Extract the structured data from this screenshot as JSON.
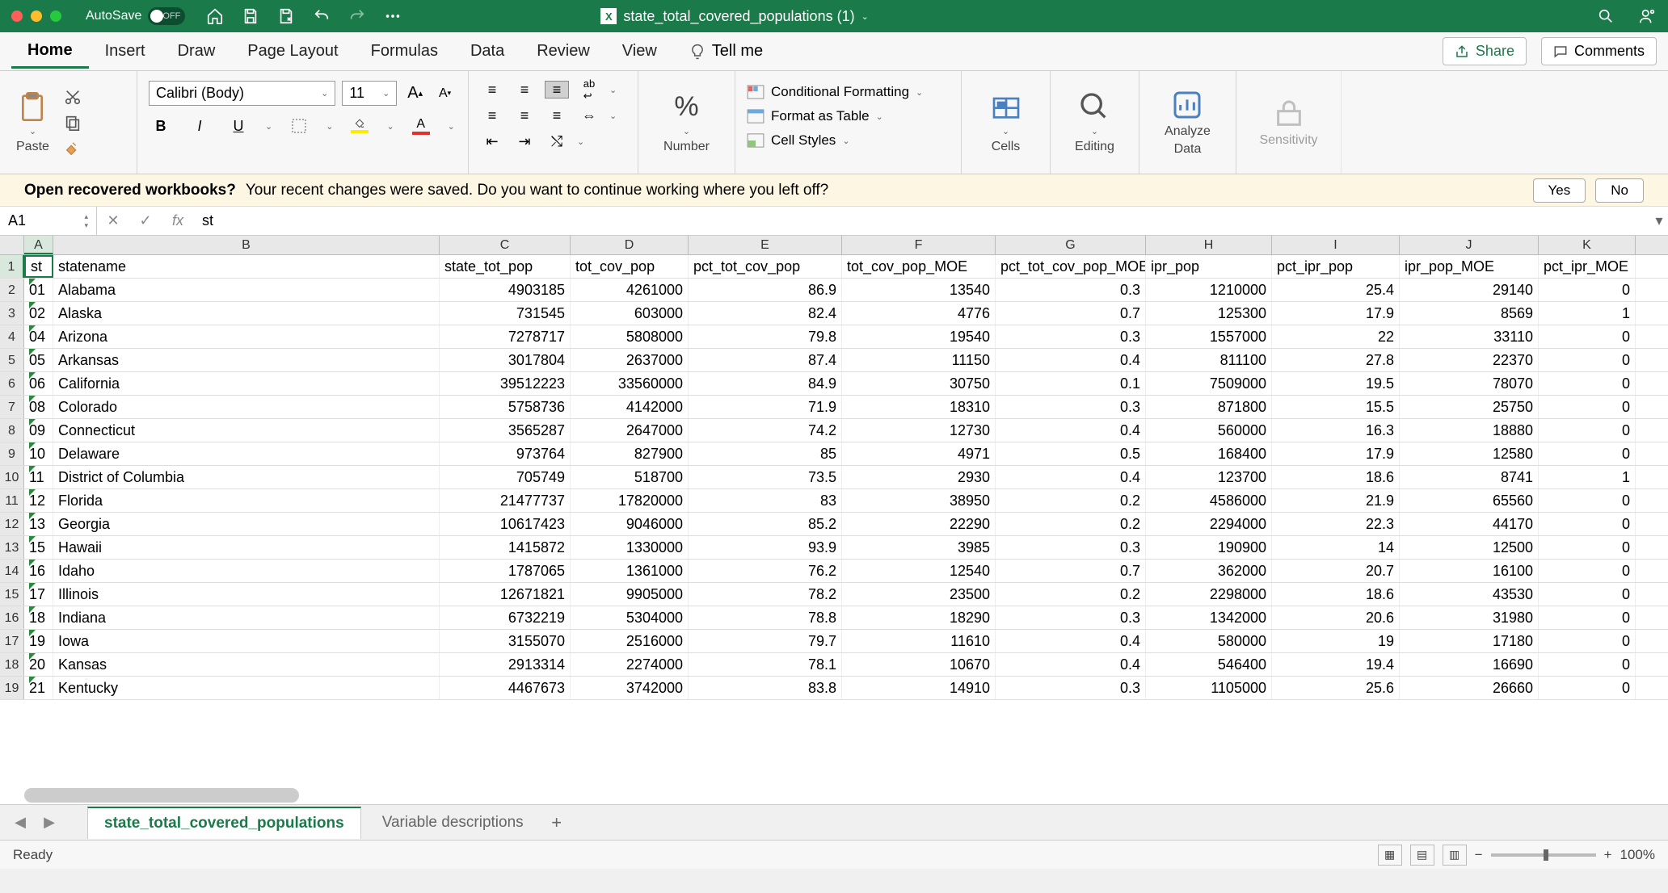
{
  "titlebar": {
    "autosave_label": "AutoSave",
    "toggle_label": "OFF",
    "doc_name": "state_total_covered_populations (1)"
  },
  "tabs": {
    "home": "Home",
    "insert": "Insert",
    "draw": "Draw",
    "pagelayout": "Page Layout",
    "formulas": "Formulas",
    "data": "Data",
    "review": "Review",
    "view": "View",
    "tellme": "Tell me",
    "share": "Share",
    "comments": "Comments"
  },
  "ribbon": {
    "paste": "Paste",
    "font_name": "Calibri (Body)",
    "font_size": "11",
    "number": "Number",
    "condfmt": "Conditional Formatting",
    "fmttable": "Format as Table",
    "cellstyles": "Cell Styles",
    "cells": "Cells",
    "editing": "Editing",
    "analyze": "Analyze",
    "analyze2": "Data",
    "sensitivity": "Sensitivity"
  },
  "recover": {
    "title": "Open recovered workbooks?",
    "msg": "Your recent changes were saved. Do you want to continue working where you left off?",
    "yes": "Yes",
    "no": "No"
  },
  "namebox": "A1",
  "formula": "st",
  "columns": [
    "A",
    "B",
    "C",
    "D",
    "E",
    "F",
    "G",
    "H",
    "I",
    "J",
    "K"
  ],
  "headers": [
    "st",
    "statename",
    "state_tot_pop",
    "tot_cov_pop",
    "pct_tot_cov_pop",
    "tot_cov_pop_MOE",
    "pct_tot_cov_pop_MOE",
    "ipr_pop",
    "pct_ipr_pop",
    "ipr_pop_MOE",
    "pct_ipr_MOE"
  ],
  "rows": [
    [
      "01",
      "Alabama",
      "4903185",
      "4261000",
      "86.9",
      "13540",
      "0.3",
      "1210000",
      "25.4",
      "29140",
      "0"
    ],
    [
      "02",
      "Alaska",
      "731545",
      "603000",
      "82.4",
      "4776",
      "0.7",
      "125300",
      "17.9",
      "8569",
      "1"
    ],
    [
      "04",
      "Arizona",
      "7278717",
      "5808000",
      "79.8",
      "19540",
      "0.3",
      "1557000",
      "22",
      "33110",
      "0"
    ],
    [
      "05",
      "Arkansas",
      "3017804",
      "2637000",
      "87.4",
      "11150",
      "0.4",
      "811100",
      "27.8",
      "22370",
      "0"
    ],
    [
      "06",
      "California",
      "39512223",
      "33560000",
      "84.9",
      "30750",
      "0.1",
      "7509000",
      "19.5",
      "78070",
      "0"
    ],
    [
      "08",
      "Colorado",
      "5758736",
      "4142000",
      "71.9",
      "18310",
      "0.3",
      "871800",
      "15.5",
      "25750",
      "0"
    ],
    [
      "09",
      "Connecticut",
      "3565287",
      "2647000",
      "74.2",
      "12730",
      "0.4",
      "560000",
      "16.3",
      "18880",
      "0"
    ],
    [
      "10",
      "Delaware",
      "973764",
      "827900",
      "85",
      "4971",
      "0.5",
      "168400",
      "17.9",
      "12580",
      "0"
    ],
    [
      "11",
      "District of Columbia",
      "705749",
      "518700",
      "73.5",
      "2930",
      "0.4",
      "123700",
      "18.6",
      "8741",
      "1"
    ],
    [
      "12",
      "Florida",
      "21477737",
      "17820000",
      "83",
      "38950",
      "0.2",
      "4586000",
      "21.9",
      "65560",
      "0"
    ],
    [
      "13",
      "Georgia",
      "10617423",
      "9046000",
      "85.2",
      "22290",
      "0.2",
      "2294000",
      "22.3",
      "44170",
      "0"
    ],
    [
      "15",
      "Hawaii",
      "1415872",
      "1330000",
      "93.9",
      "3985",
      "0.3",
      "190900",
      "14",
      "12500",
      "0"
    ],
    [
      "16",
      "Idaho",
      "1787065",
      "1361000",
      "76.2",
      "12540",
      "0.7",
      "362000",
      "20.7",
      "16100",
      "0"
    ],
    [
      "17",
      "Illinois",
      "12671821",
      "9905000",
      "78.2",
      "23500",
      "0.2",
      "2298000",
      "18.6",
      "43530",
      "0"
    ],
    [
      "18",
      "Indiana",
      "6732219",
      "5304000",
      "78.8",
      "18290",
      "0.3",
      "1342000",
      "20.6",
      "31980",
      "0"
    ],
    [
      "19",
      "Iowa",
      "3155070",
      "2516000",
      "79.7",
      "11610",
      "0.4",
      "580000",
      "19",
      "17180",
      "0"
    ],
    [
      "20",
      "Kansas",
      "2913314",
      "2274000",
      "78.1",
      "10670",
      "0.4",
      "546400",
      "19.4",
      "16690",
      "0"
    ],
    [
      "21",
      "Kentucky",
      "4467673",
      "3742000",
      "83.8",
      "14910",
      "0.3",
      "1105000",
      "25.6",
      "26660",
      "0"
    ]
  ],
  "sheets": {
    "active": "state_total_covered_populations",
    "other": "Variable descriptions"
  },
  "status": {
    "ready": "Ready",
    "zoom": "100%"
  }
}
